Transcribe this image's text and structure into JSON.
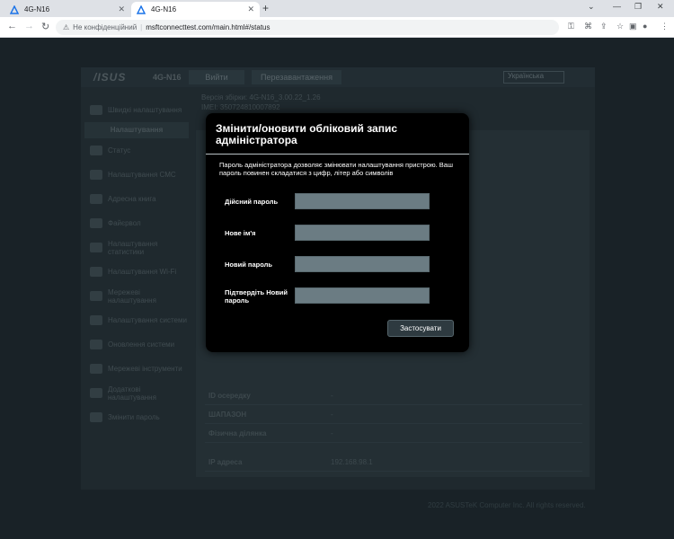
{
  "browser": {
    "tabs": [
      {
        "title": "4G-N16",
        "active": false
      },
      {
        "title": "4G-N16",
        "active": true
      }
    ],
    "new_tab": "+",
    "address": {
      "security_label": "Не конфіденційний",
      "url": "msftconnecttest.com/main.html#/status"
    },
    "icons": [
      "back-icon",
      "forward-icon",
      "reload-icon",
      "key-icon",
      "translate-icon",
      "share-icon",
      "star-icon",
      "sidepanel-icon",
      "profile-icon",
      "menu-icon"
    ]
  },
  "router": {
    "logo": "/ISUS",
    "model": "4G-N16",
    "top_buttons": [
      "Вийти",
      "Перезавантаження"
    ],
    "language": "Українська",
    "info_line1": "Версія збірки: 4G-N16_3.00.22_1.26",
    "info_line2": "IMEI: 350724810007892",
    "sidebar": {
      "quick": "Швидкі налаштування",
      "section": "Налаштування",
      "items": [
        "Статус",
        "Налаштування СМС",
        "Адресна книга",
        "Файєрвол",
        "Налаштування статистики",
        "Налаштування Wi-Fi",
        "Мережеві налаштування",
        "Налаштування системи",
        "Оновлення системи",
        "Мережеві інструменти",
        "Додаткові налаштування",
        "Змінити пароль"
      ]
    },
    "status_rows": [
      {
        "label": "ID осередку",
        "value": "-"
      },
      {
        "label": "ШАПАЗОН",
        "value": "-"
      },
      {
        "label": "Фізична ділянка",
        "value": "-"
      },
      {
        "label": "IP адреса",
        "value": "192.168.98.1"
      }
    ],
    "copyright": "2022 ASUSTeK Computer Inc. All rights reserved."
  },
  "modal": {
    "title": "Змінити/оновити обліковий запис адміністратора",
    "description": "Пароль адміністратора дозволяє змінювати налаштування пристрою. Ваш пароль повинен складатися з цифр, літер або символів",
    "fields": [
      {
        "label": "Дійсний пароль",
        "value": ""
      },
      {
        "label": "Нове ім'я",
        "value": ""
      },
      {
        "label": "Новий пароль",
        "value": ""
      },
      {
        "label": "Підтвердіть Новий пароль",
        "value": ""
      }
    ],
    "apply_label": "Застосувати"
  }
}
